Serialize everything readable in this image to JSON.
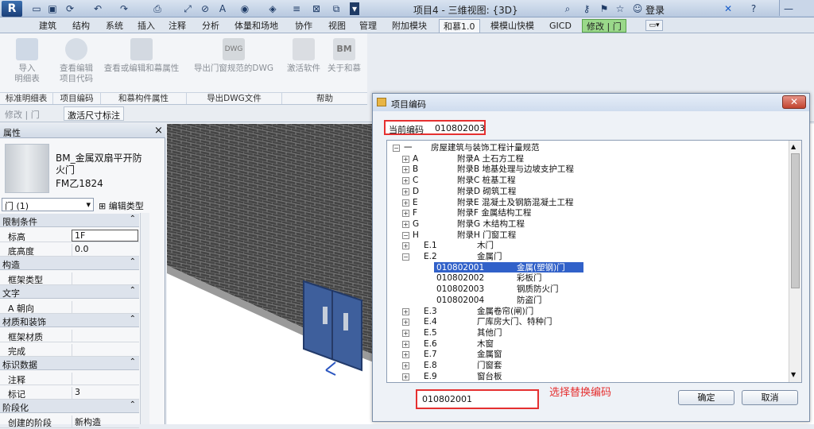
{
  "titlebar": {
    "app_logo": "R",
    "title": "项目4 - 三维视图: {3D}",
    "login": "登录"
  },
  "tabs": [
    {
      "label": "建筑"
    },
    {
      "label": "结构"
    },
    {
      "label": "系统"
    },
    {
      "label": "插入"
    },
    {
      "label": "注释"
    },
    {
      "label": "分析"
    },
    {
      "label": "体量和场地"
    },
    {
      "label": "协作"
    },
    {
      "label": "视图"
    },
    {
      "label": "管理"
    },
    {
      "label": "附加模块"
    },
    {
      "label": "和慕1.0"
    },
    {
      "label": "模模山快模"
    },
    {
      "label": "GICD"
    },
    {
      "label": "修改 | 门"
    }
  ],
  "ribbon": {
    "buttons": [
      {
        "label": "导入\n明细表"
      },
      {
        "label": "查看编辑\n项目代码"
      },
      {
        "label": "查看或编辑和幕属性"
      },
      {
        "label": "导出门窗规范的DWG"
      },
      {
        "label": "激活软件"
      },
      {
        "label": "关于和慕"
      }
    ],
    "groups": [
      {
        "label": "标准明细表"
      },
      {
        "label": "项目编码"
      },
      {
        "label": "和慕构件属性"
      },
      {
        "label": "导出DWG文件"
      },
      {
        "label": "帮助"
      }
    ]
  },
  "optbar": {
    "left": "修改 | 门",
    "right": "激活尺寸标注"
  },
  "properties": {
    "title": "属性",
    "family_name": "BM_金属双扇平开防火门",
    "family_type": "FM乙1824",
    "selector": "门 (1)",
    "edit_type": "编辑类型",
    "rows": [
      {
        "kind": "head",
        "k": "限制条件"
      },
      {
        "kind": "row",
        "k": "标高",
        "v": "1F"
      },
      {
        "kind": "row",
        "k": "底高度",
        "v": "0.0"
      },
      {
        "kind": "head",
        "k": "构造"
      },
      {
        "kind": "row",
        "k": "框架类型",
        "v": ""
      },
      {
        "kind": "head",
        "k": "文字"
      },
      {
        "kind": "row",
        "k": "A 朝向",
        "v": ""
      },
      {
        "kind": "head",
        "k": "材质和装饰"
      },
      {
        "kind": "row",
        "k": "框架材质",
        "v": ""
      },
      {
        "kind": "row",
        "k": "完成",
        "v": ""
      },
      {
        "kind": "head",
        "k": "标识数据"
      },
      {
        "kind": "row",
        "k": "注释",
        "v": ""
      },
      {
        "kind": "row",
        "k": "标记",
        "v": "3"
      },
      {
        "kind": "head",
        "k": "阶段化"
      },
      {
        "kind": "row",
        "k": "创建的阶段",
        "v": "新构造"
      }
    ]
  },
  "dialog": {
    "title": "项目编码",
    "current_code_label": "当前编码",
    "current_code": "010802003",
    "selected_code": "010802001",
    "hint": "选择替换编码",
    "ok": "确定",
    "cancel": "取消",
    "tree": [
      {
        "code": "一",
        "name": "房屋建筑与装饰工程计量规范",
        "level": 0
      },
      {
        "code": "A",
        "name": "附录A  土石方工程",
        "level": 1
      },
      {
        "code": "B",
        "name": "附录B  地基处理与边坡支护工程",
        "level": 1
      },
      {
        "code": "C",
        "name": "附录C  桩基工程",
        "level": 1
      },
      {
        "code": "D",
        "name": "附录D  砌筑工程",
        "level": 1
      },
      {
        "code": "E",
        "name": "附录E  混凝土及钢筋混凝土工程",
        "level": 1
      },
      {
        "code": "F",
        "name": "附录F  金属结构工程",
        "level": 1
      },
      {
        "code": "G",
        "name": "附录G  木结构工程",
        "level": 1
      },
      {
        "code": "H",
        "name": "附录H  门窗工程",
        "level": 1
      },
      {
        "code": "E.1",
        "name": "木门",
        "level": 2
      },
      {
        "code": "E.2",
        "name": "金属门",
        "level": 2
      },
      {
        "code": "010802001",
        "name": "金属(塑钢)门",
        "level": 3,
        "selected": true
      },
      {
        "code": "010802002",
        "name": "彩板门",
        "level": 3
      },
      {
        "code": "010802003",
        "name": "钢质防火门",
        "level": 3
      },
      {
        "code": "010802004",
        "name": "防盗门",
        "level": 3
      },
      {
        "code": "E.3",
        "name": "金属卷帘(闸)门",
        "level": 2
      },
      {
        "code": "E.4",
        "name": "厂库房大门、特种门",
        "level": 2
      },
      {
        "code": "E.5",
        "name": "其他门",
        "level": 2
      },
      {
        "code": "E.6",
        "name": "木窗",
        "level": 2
      },
      {
        "code": "E.7",
        "name": "金属窗",
        "level": 2
      },
      {
        "code": "E.8",
        "name": "门窗套",
        "level": 2
      },
      {
        "code": "E.9",
        "name": "窗台板",
        "level": 2
      }
    ]
  },
  "colors": {
    "highlight": "#e53030",
    "selection": "#3161c9",
    "modify_tab": "#9ad88a"
  }
}
